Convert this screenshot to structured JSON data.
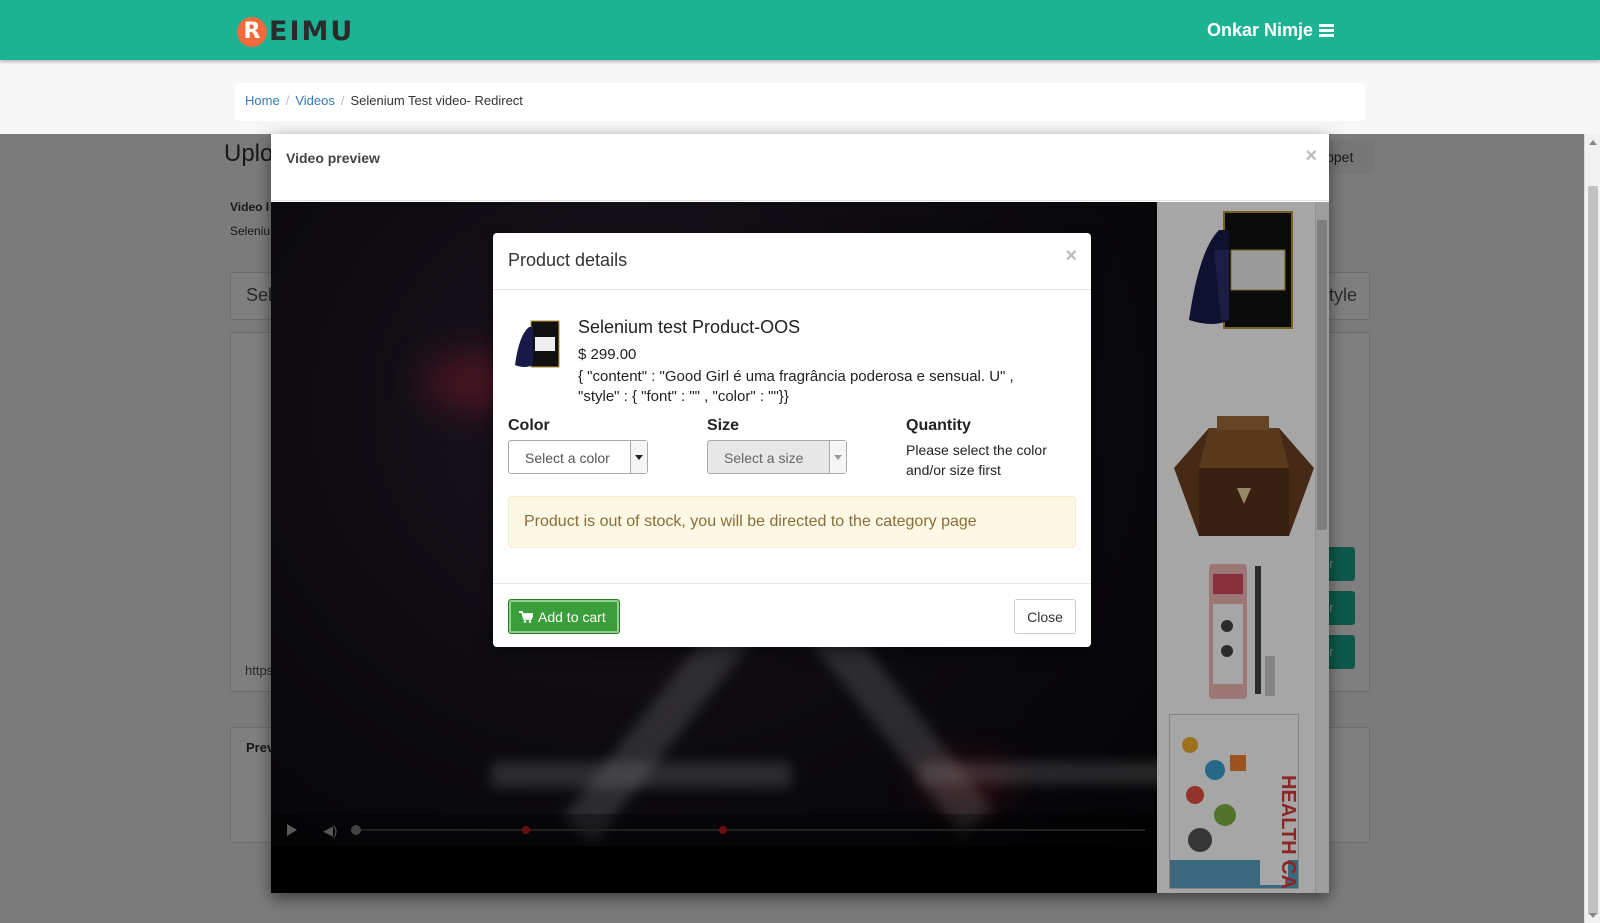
{
  "header": {
    "logo_mark": "R",
    "logo_text": "EIMU",
    "user_name": "Onkar Nimje",
    "menu_icon": "hamburger-icon",
    "brand_color": "#1bb394"
  },
  "breadcrumb": {
    "items": [
      "Home",
      "Videos",
      "Selenium Test video- Redirect"
    ],
    "separator": "/"
  },
  "background_page": {
    "title_fragment": "Uplo",
    "snippet_fragment": "ippet",
    "video_label_fragment": "Video I",
    "video_value_fragment": "Seleniu",
    "panel_left_fragment": "Sel",
    "panel_right_fragment": "tyle",
    "url_fragment": "https",
    "preview_fragment": "Prev",
    "btn_fragment": "or"
  },
  "video_modal": {
    "title": "Video preview",
    "close_symbol": "×",
    "controls": {
      "play_icon": "play-icon",
      "volume_icon": "volume-icon"
    }
  },
  "product_strip": {
    "items": [
      "perfume-bottle-heel",
      "perfume-bottle-gem",
      "eyebrow-pencil",
      "health-care-book"
    ]
  },
  "product_modal": {
    "title": "Product details",
    "close_symbol": "×",
    "product_name": "Selenium test Product-OOS",
    "price": "$ 299.00",
    "description": "{ \"content\" : \"Good Girl é uma fragrância poderosa e sensual. U\" , \"style\" : { \"font\" : \"\" , \"color\" : \"\"}}",
    "color_label": "Color",
    "color_placeholder": "Select a color",
    "size_label": "Size",
    "size_placeholder": "Select a size",
    "quantity_label": "Quantity",
    "quantity_help": "Please select the color and/or size first",
    "alert": "Product is out of stock, you will be directed to the category page",
    "add_to_cart": "Add to cart",
    "close_button": "Close"
  }
}
